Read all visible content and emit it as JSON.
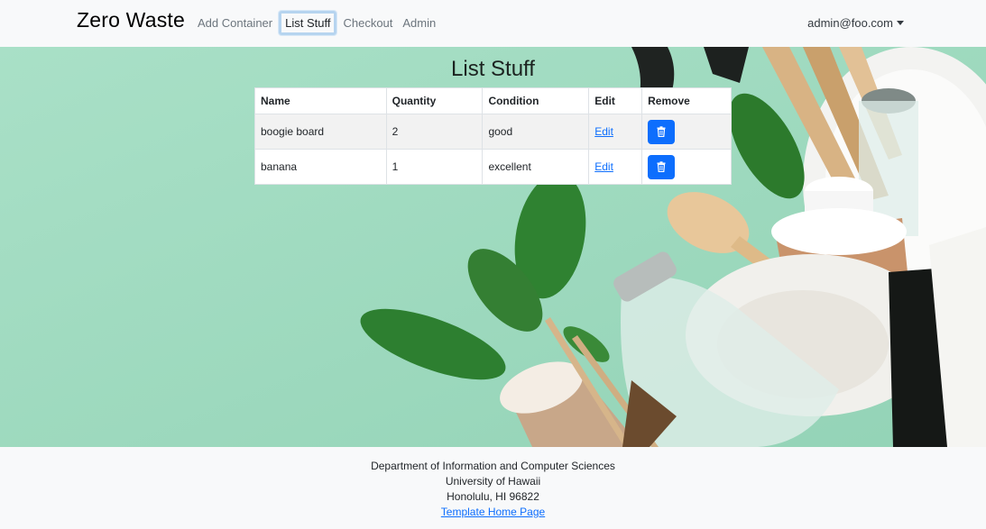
{
  "navbar": {
    "brand": "Zero Waste",
    "links": [
      {
        "label": "Add Container"
      },
      {
        "label": "List Stuff"
      },
      {
        "label": "Checkout"
      },
      {
        "label": "Admin"
      }
    ],
    "user": "admin@foo.com"
  },
  "page": {
    "title": "List Stuff"
  },
  "table": {
    "headers": [
      "Name",
      "Quantity",
      "Condition",
      "Edit",
      "Remove"
    ],
    "rows": [
      {
        "name": "boogie board",
        "quantity": "2",
        "condition": "good",
        "edit": "Edit"
      },
      {
        "name": "banana",
        "quantity": "1",
        "condition": "excellent",
        "edit": "Edit"
      }
    ],
    "remove_icon": "trash-icon"
  },
  "footer": {
    "line1": "Department of Information and Computer Sciences",
    "line2": "University of Hawaii",
    "line3": "Honolulu, HI 96822",
    "link": "Template Home Page"
  },
  "colors": {
    "primary": "#0d6efd",
    "hero_background": "#a7dfc5"
  }
}
